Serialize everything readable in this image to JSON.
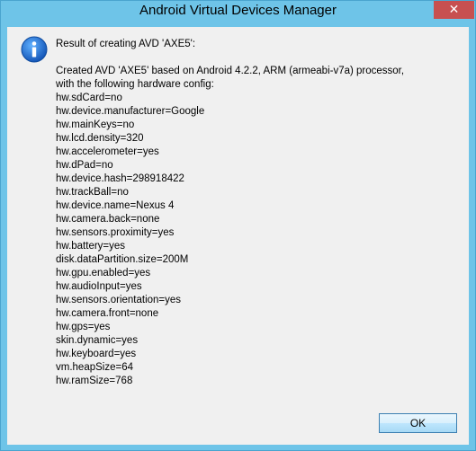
{
  "window": {
    "title": "Android Virtual Devices Manager",
    "close_glyph": "✕"
  },
  "dialog": {
    "icon": "info-icon",
    "heading": "Result of creating AVD 'AXE5':",
    "summary_line1": "Created AVD 'AXE5' based on Android 4.2.2, ARM (armeabi-v7a) processor,",
    "summary_line2": "with the following hardware config:",
    "config": [
      "hw.sdCard=no",
      "hw.device.manufacturer=Google",
      "hw.mainKeys=no",
      "hw.lcd.density=320",
      "hw.accelerometer=yes",
      "hw.dPad=no",
      "hw.device.hash=298918422",
      "hw.trackBall=no",
      "hw.device.name=Nexus 4",
      "hw.camera.back=none",
      "hw.sensors.proximity=yes",
      "hw.battery=yes",
      "disk.dataPartition.size=200M",
      "hw.gpu.enabled=yes",
      "hw.audioInput=yes",
      "hw.sensors.orientation=yes",
      "hw.camera.front=none",
      "hw.gps=yes",
      "skin.dynamic=yes",
      "hw.keyboard=yes",
      "vm.heapSize=64",
      "hw.ramSize=768"
    ],
    "ok_label": "OK"
  },
  "colors": {
    "frame": "#6ec4e8",
    "close_button": "#c75050",
    "client_bg": "#f0f0f0",
    "info_icon": "#1e73d2"
  }
}
